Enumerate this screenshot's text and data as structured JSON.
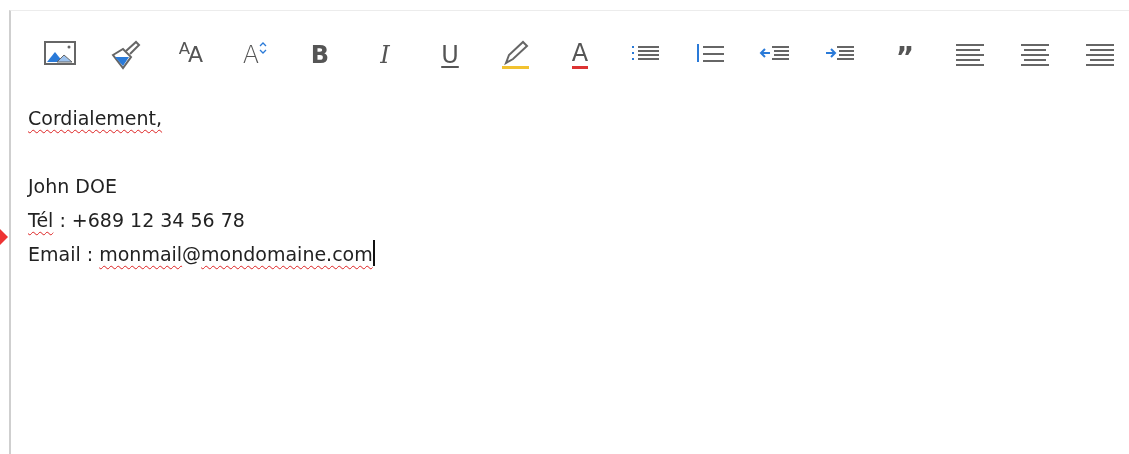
{
  "toolbar": [
    {
      "kind": "image"
    },
    {
      "kind": "paint"
    },
    {
      "kind": "font-size",
      "label": "$^{A}$A"
    },
    {
      "kind": "grow-font",
      "label": "A"
    },
    {
      "kind": "bold",
      "label": "B"
    },
    {
      "kind": "italic",
      "label": "I"
    },
    {
      "kind": "underline",
      "label": "U"
    },
    {
      "kind": "highlight"
    },
    {
      "kind": "font-color",
      "label": "A"
    },
    {
      "kind": "bullets"
    },
    {
      "kind": "numbering"
    },
    {
      "kind": "outdent"
    },
    {
      "kind": "indent"
    },
    {
      "kind": "quote",
      "label": "”"
    },
    {
      "kind": "align-left"
    },
    {
      "kind": "align-center"
    },
    {
      "kind": "align-right"
    }
  ],
  "editor": {
    "cursor_at_end": true,
    "closing": [
      {
        "text": "Cordialement,",
        "misspelled": true
      }
    ],
    "lines": [
      [
        {
          "text": "John DOE",
          "misspelled": false
        }
      ],
      [
        {
          "text": "Tél",
          "misspelled": true
        },
        {
          "text": " : +689 12 34 56 78",
          "misspelled": false
        }
      ],
      [
        {
          "text": "Email : ",
          "misspelled": false
        },
        {
          "text": "monmail",
          "misspelled": true
        },
        {
          "text": "@",
          "misspelled": false
        },
        {
          "text": "mondomaine.com",
          "misspelled": true
        }
      ]
    ]
  }
}
